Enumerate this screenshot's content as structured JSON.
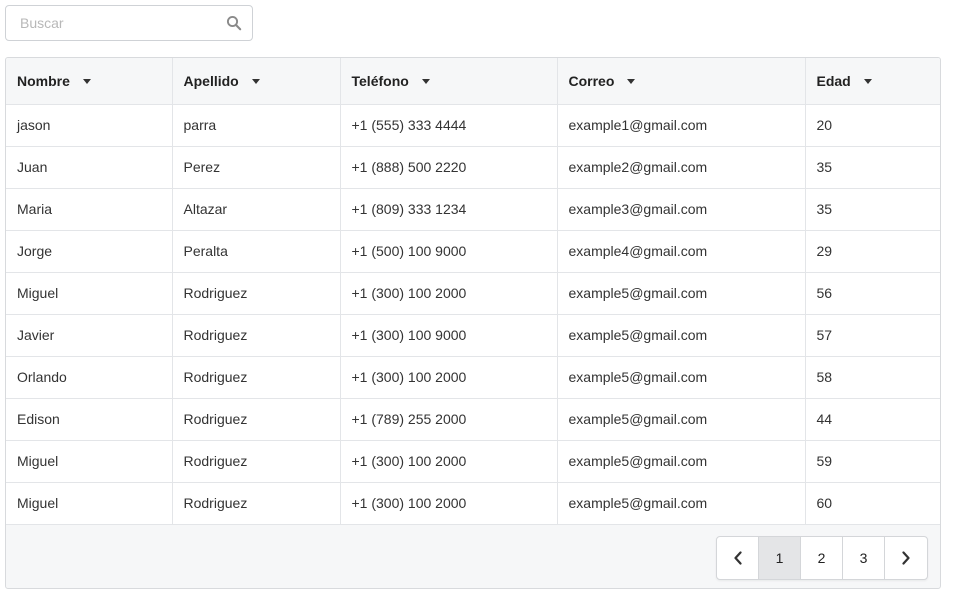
{
  "search": {
    "placeholder": "Buscar",
    "value": ""
  },
  "table": {
    "columns": [
      "Nombre",
      "Apellido",
      "Teléfono",
      "Correo",
      "Edad"
    ],
    "rows": [
      [
        "jason",
        "parra",
        "+1 (555) 333 4444",
        "example1@gmail.com",
        "20"
      ],
      [
        "Juan",
        "Perez",
        "+1 (888) 500 2220",
        "example2@gmail.com",
        "35"
      ],
      [
        "Maria",
        "Altazar",
        "+1 (809) 333 1234",
        "example3@gmail.com",
        "35"
      ],
      [
        "Jorge",
        "Peralta",
        "+1 (500) 100 9000",
        "example4@gmail.com",
        "29"
      ],
      [
        "Miguel",
        "Rodriguez",
        "+1 (300) 100 2000",
        "example5@gmail.com",
        "56"
      ],
      [
        "Javier",
        "Rodriguez",
        "+1 (300) 100 9000",
        "example5@gmail.com",
        "57"
      ],
      [
        "Orlando",
        "Rodriguez",
        "+1 (300) 100 2000",
        "example5@gmail.com",
        "58"
      ],
      [
        "Edison",
        "Rodriguez",
        "+1 (789) 255 2000",
        "example5@gmail.com",
        "44"
      ],
      [
        "Miguel",
        "Rodriguez",
        "+1 (300) 100 2000",
        "example5@gmail.com",
        "59"
      ],
      [
        "Miguel",
        "Rodriguez",
        "+1 (300) 100 2000",
        "example5@gmail.com",
        "60"
      ]
    ]
  },
  "pagination": {
    "pages": [
      "1",
      "2",
      "3"
    ],
    "current_page": "1"
  },
  "icons": {
    "search": "search-icon",
    "sort": "sort-down-icon",
    "prev": "chevron-left-icon",
    "next": "chevron-right-icon"
  },
  "colors": {
    "border": "#d8dadd",
    "header_bg": "#f6f7f8",
    "active_page_bg": "#e4e5e7",
    "placeholder": "#b8b8b8"
  }
}
